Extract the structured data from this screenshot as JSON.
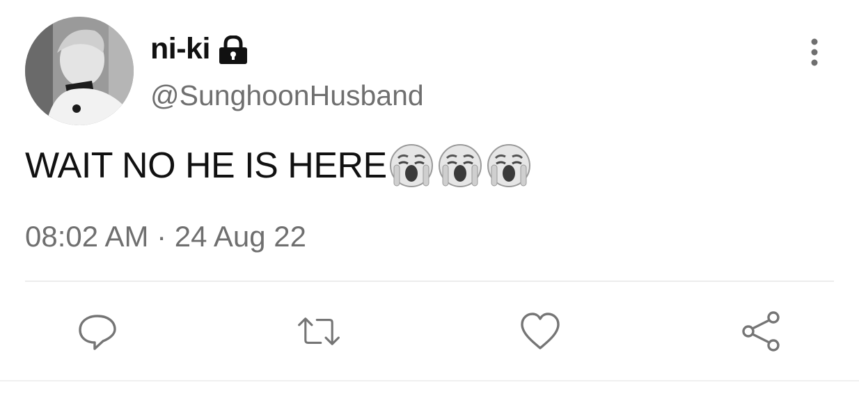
{
  "author": {
    "display_name": "ni-ki",
    "handle": "@SunghoonHusband",
    "avatar_icon": "profile-photo",
    "protected_icon": "lock-icon"
  },
  "tweet": {
    "text": "WAIT NO HE IS HERE",
    "emojis": [
      "😭",
      "😭",
      "😭"
    ],
    "timestamp": "08:02 AM · 24 Aug 22"
  },
  "actions": [
    {
      "name": "reply",
      "icon": "reply-icon"
    },
    {
      "name": "retweet",
      "icon": "retweet-icon"
    },
    {
      "name": "like",
      "icon": "heart-icon"
    },
    {
      "name": "share",
      "icon": "share-icon"
    }
  ],
  "menu_icon": "more-vertical-icon",
  "colors": {
    "text_primary": "#111111",
    "text_secondary": "#6f6f6f",
    "icon": "#757575",
    "divider": "#ececec"
  }
}
